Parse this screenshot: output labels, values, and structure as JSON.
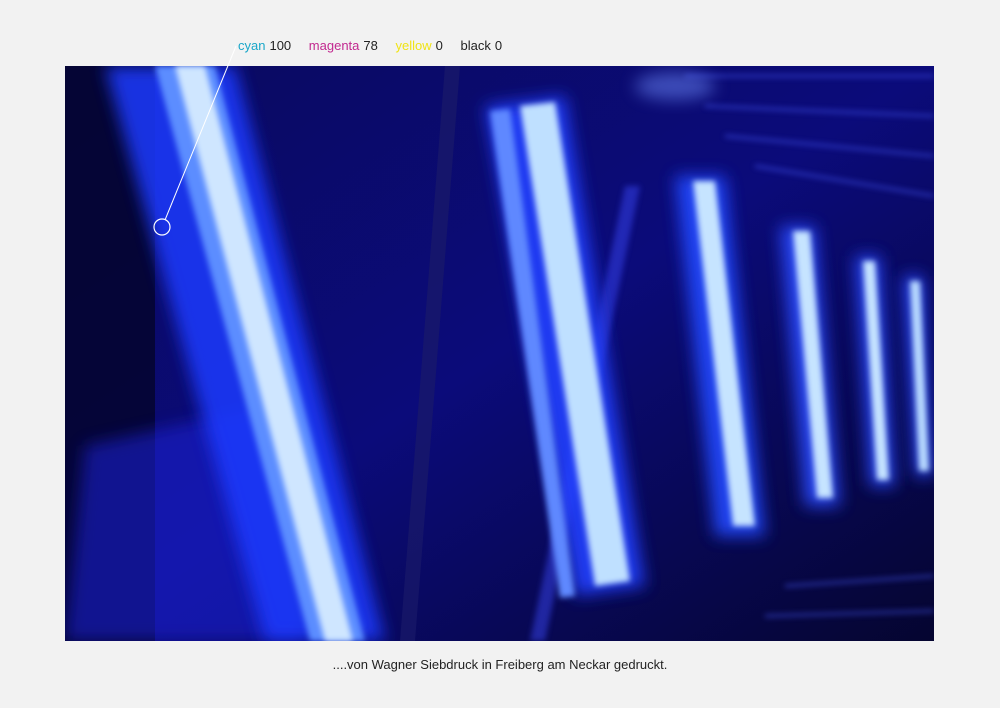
{
  "swatch": {
    "cyan": {
      "name": "cyan",
      "value": "100",
      "color": "#1aa7c9"
    },
    "magenta": {
      "name": "magenta",
      "value": "78",
      "color": "#c2288f"
    },
    "yellow": {
      "name": "yellow",
      "value": "0",
      "color": "#f0e416"
    },
    "black": {
      "name": "black",
      "value": "0",
      "color": "#222222"
    }
  },
  "photo": {
    "subject": "blue fluorescent tubes",
    "tube_color": "#3a5cff",
    "glow_color": "#cfe6ff"
  },
  "caption": "....von Wagner Siebdruck in Freiberg am Neckar gedruckt."
}
